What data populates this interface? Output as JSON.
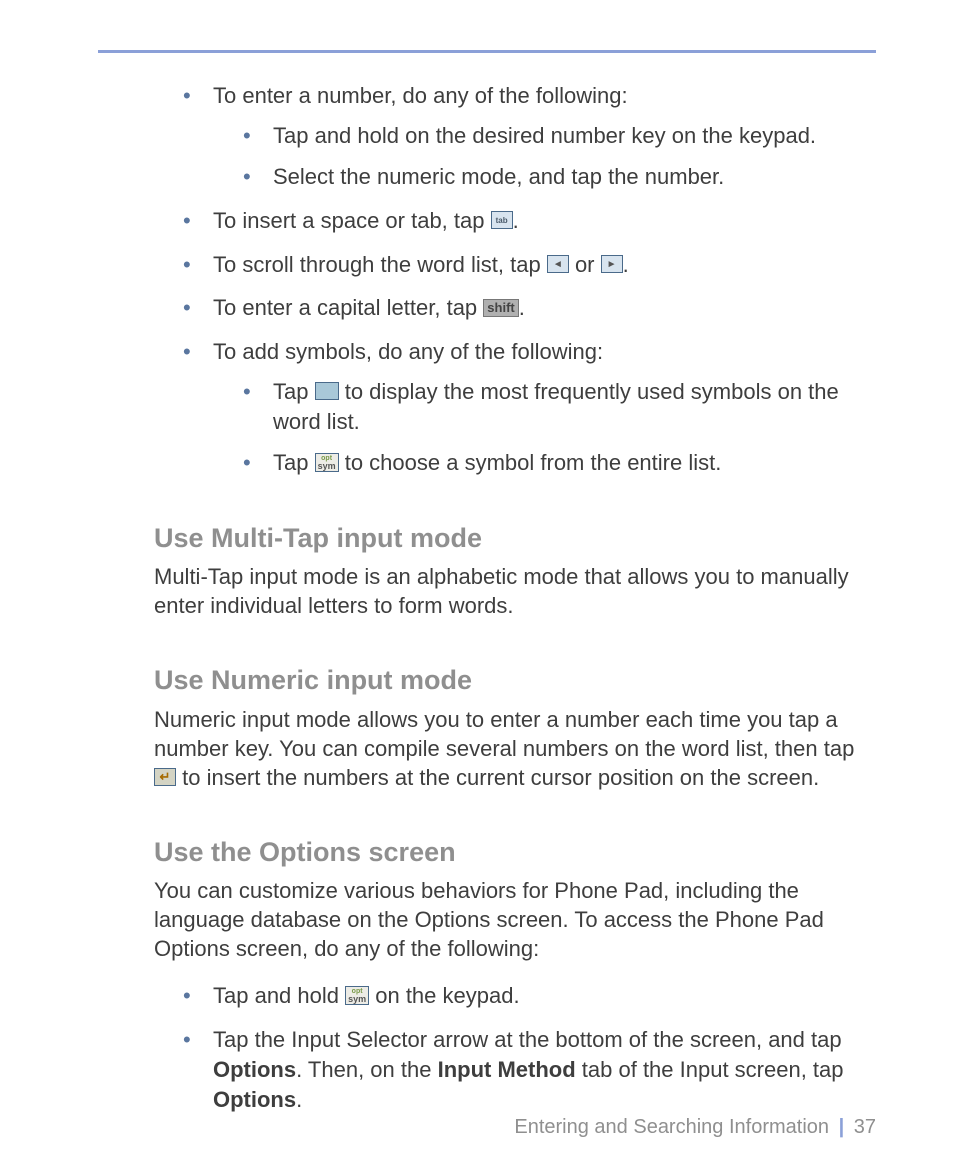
{
  "bullets": {
    "number_intro": "To enter a number, do any of the following:",
    "number_hold": "Tap and hold on the desired number key on the keypad.",
    "number_select": "Select the numeric mode, and tap the number.",
    "space_before": "To insert a space or tab, tap ",
    "scroll_before": "To scroll through the word list, tap ",
    "scroll_mid": " or ",
    "capital_before": "To enter a capital letter, tap ",
    "symbols_intro": "To add symbols, do any of the following:",
    "symbols_smile_before": "Tap ",
    "symbols_smile_after": " to display the most frequently used symbols on the word list.",
    "symbols_sym_before": "Tap ",
    "symbols_sym_after": " to choose a symbol from the entire list."
  },
  "sections": {
    "multitap_h": "Use Multi-Tap input mode",
    "multitap_p": "Multi-Tap input mode is an alphabetic mode that allows you to manually enter individual letters to form words.",
    "numeric_h": "Use Numeric input mode",
    "numeric_p_before": "Numeric input mode allows you to enter a number each time you tap a number key. You can compile several numbers on the word list, then tap ",
    "numeric_p_after": " to insert the numbers at the current cursor position on the screen.",
    "options_h": "Use the Options screen",
    "options_p": "You can customize various behaviors for Phone Pad, including the language database on the Options screen. To access the Phone Pad Options screen, do any of the following:",
    "options_hold_before": "Tap and hold ",
    "options_hold_after": " on the keypad.",
    "options_selector_1": "Tap the Input Selector arrow at the bottom of the screen, and tap ",
    "options_selector_b1": "Options",
    "options_selector_2": ". Then, on the ",
    "options_selector_b2": "Input Method",
    "options_selector_3": " tab of the Input screen, tap ",
    "options_selector_b3": "Options",
    "options_selector_4": "."
  },
  "footer": {
    "chapter": "Entering and Searching Information",
    "page": "37"
  }
}
